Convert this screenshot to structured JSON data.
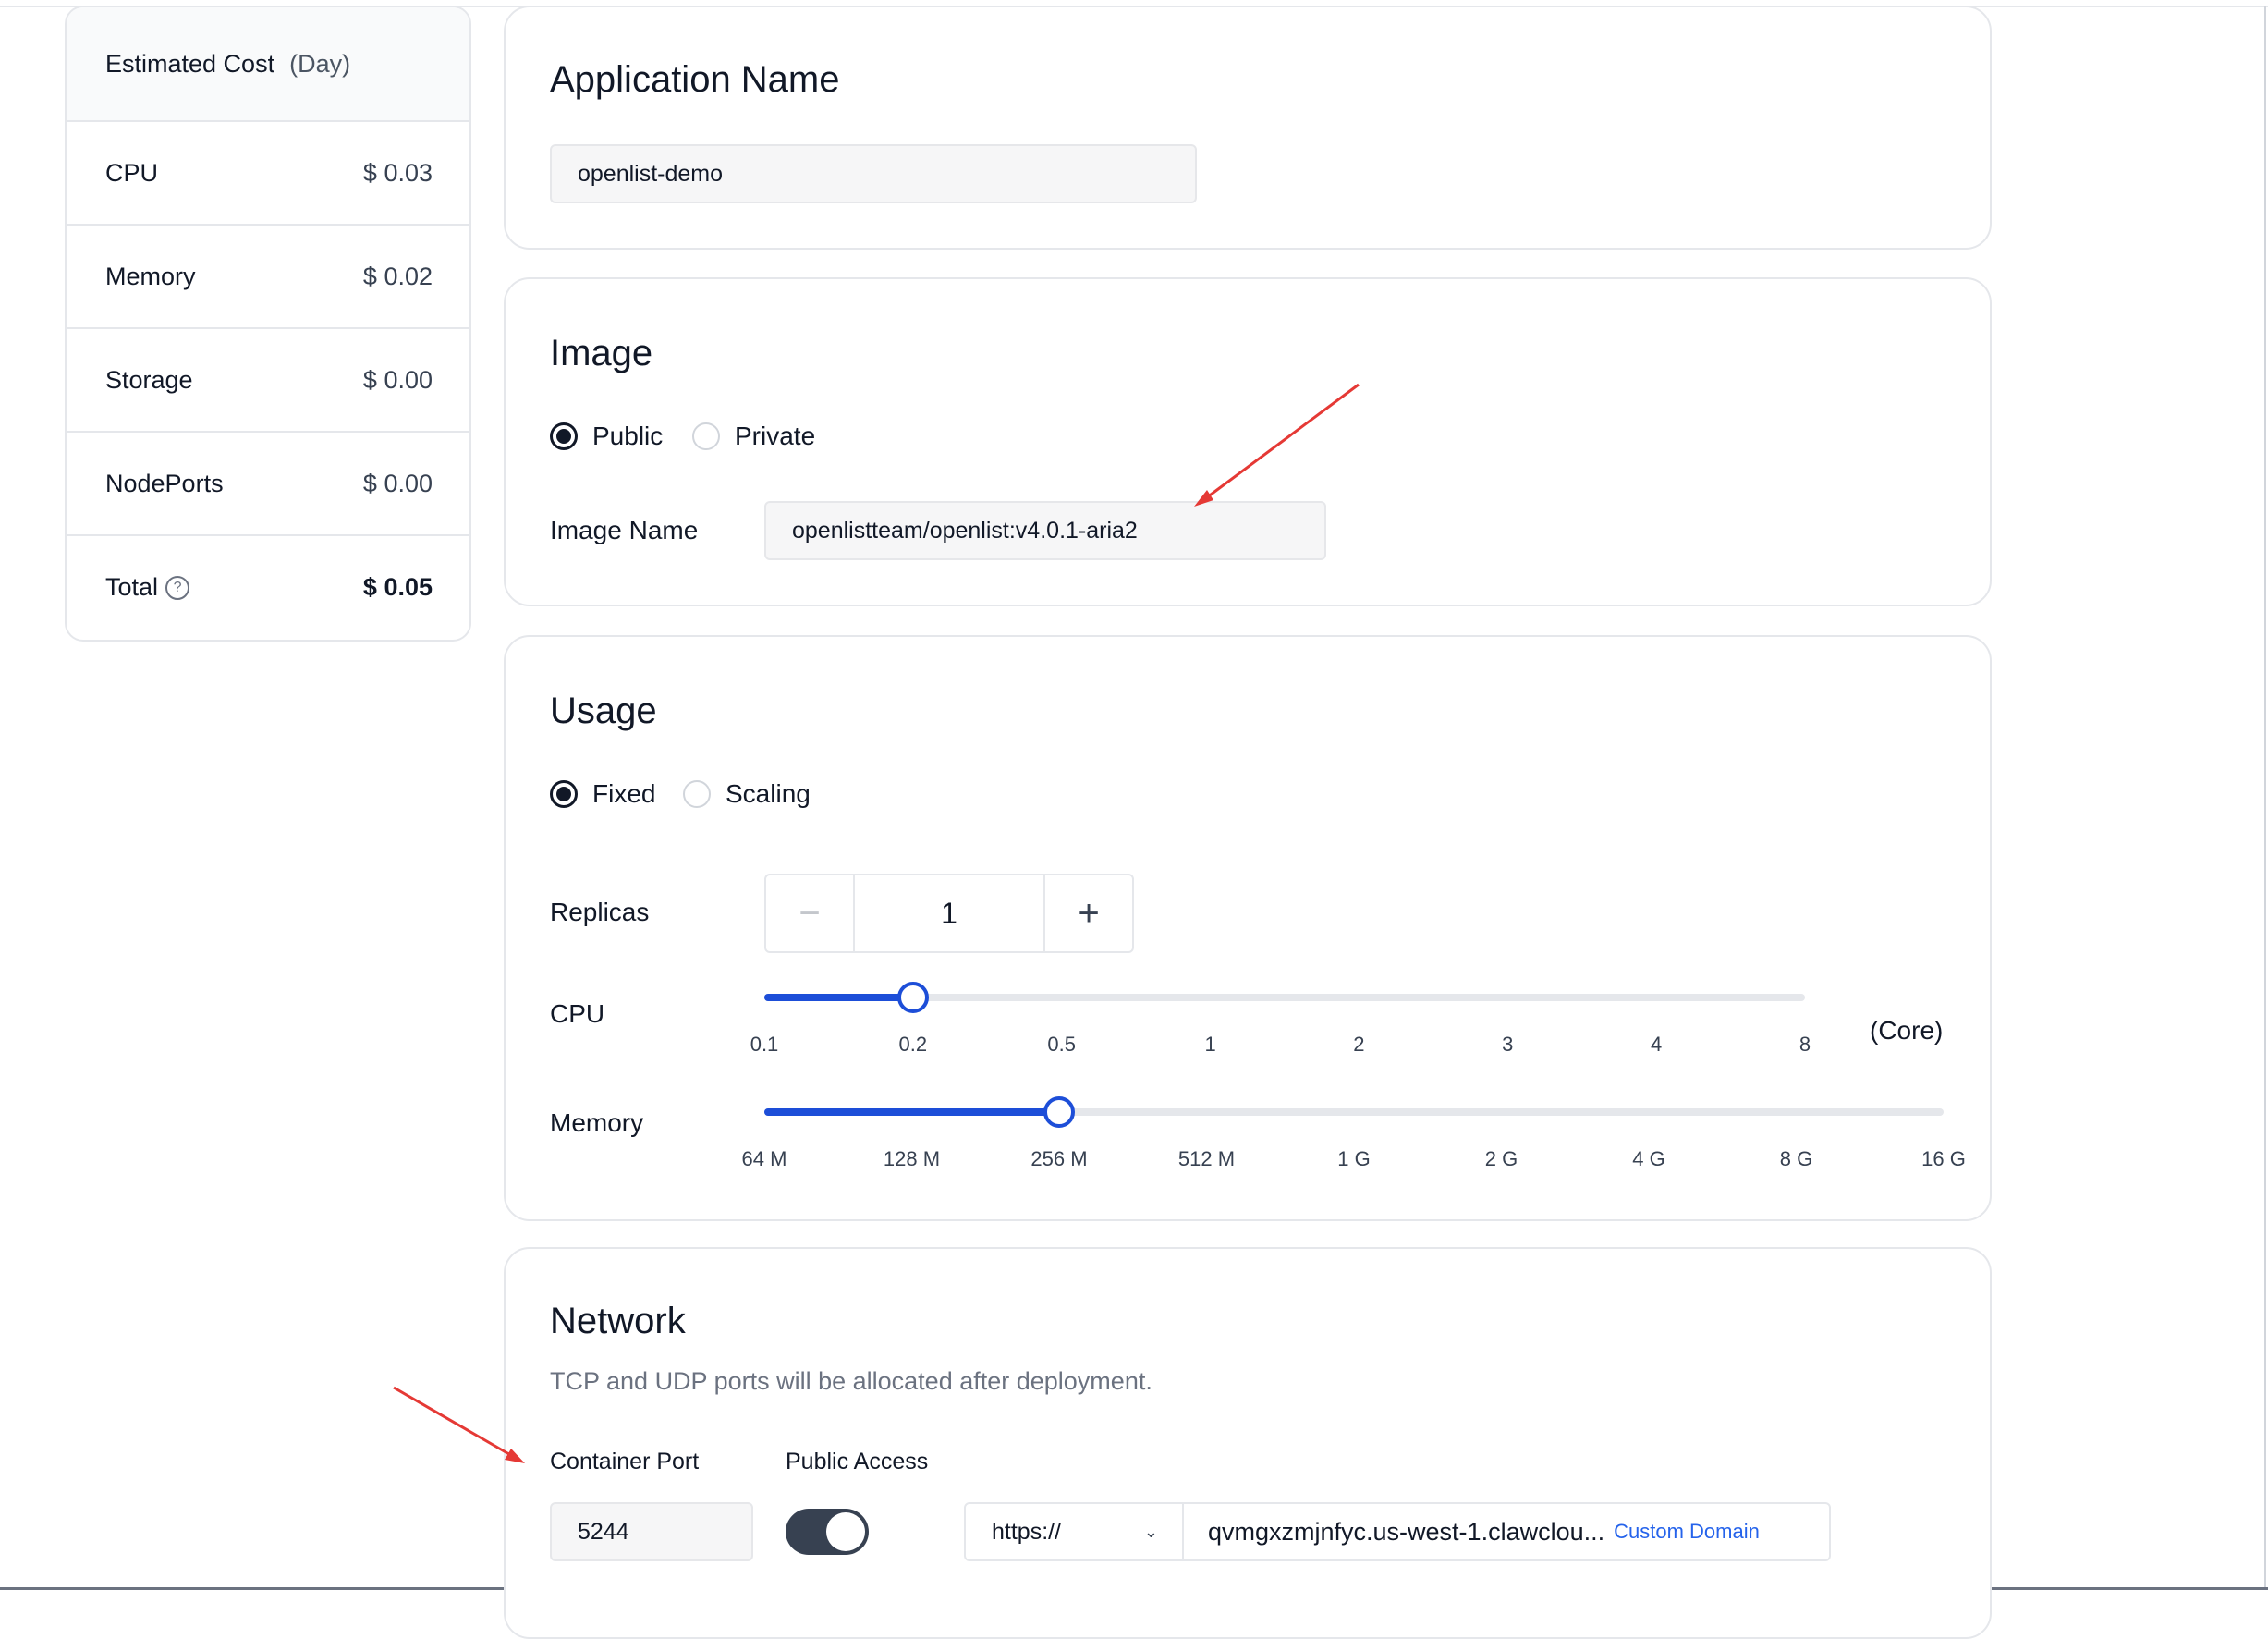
{
  "cost": {
    "title": "Estimated Cost",
    "unit": "(Day)",
    "rows": [
      {
        "label": "CPU",
        "value": "$ 0.03"
      },
      {
        "label": "Memory",
        "value": "$ 0.02"
      },
      {
        "label": "Storage",
        "value": "$ 0.00"
      },
      {
        "label": "NodePorts",
        "value": "$ 0.00"
      }
    ],
    "total": {
      "label": "Total",
      "value": "$ 0.05",
      "help_icon": "question-circle-icon"
    }
  },
  "app": {
    "title": "Application Name",
    "value": "openlist-demo"
  },
  "image": {
    "title": "Image",
    "options": [
      "Public",
      "Private"
    ],
    "selected": "Public",
    "name_label": "Image Name",
    "name_value": "openlistteam/openlist:v4.0.1-aria2"
  },
  "usage": {
    "title": "Usage",
    "options": [
      "Fixed",
      "Scaling"
    ],
    "selected": "Fixed",
    "replicas_label": "Replicas",
    "replicas_value": "1",
    "minus_icon": "minus-icon",
    "plus_icon": "plus-icon",
    "cpu": {
      "label": "CPU",
      "unit": "(Core)",
      "ticks": [
        "0.1",
        "0.2",
        "0.5",
        "1",
        "2",
        "3",
        "4",
        "8"
      ],
      "selected": "0.2"
    },
    "memory": {
      "label": "Memory",
      "ticks": [
        "64 M",
        "128 M",
        "256 M",
        "512 M",
        "1 G",
        "2 G",
        "4 G",
        "8 G",
        "16 G"
      ],
      "selected": "256 M"
    },
    "accent": "#1d4ed8"
  },
  "network": {
    "title": "Network",
    "note": "TCP and UDP ports will be allocated after deployment.",
    "port_label": "Container Port",
    "access_label": "Public Access",
    "port_value": "5244",
    "public_access": true,
    "protocol": "https://",
    "domain": "qvmgxzmjnfyc.us-west-1.clawclou...",
    "custom_domain": "Custom Domain"
  },
  "annotations": {
    "arrow_color": "#e53935"
  }
}
